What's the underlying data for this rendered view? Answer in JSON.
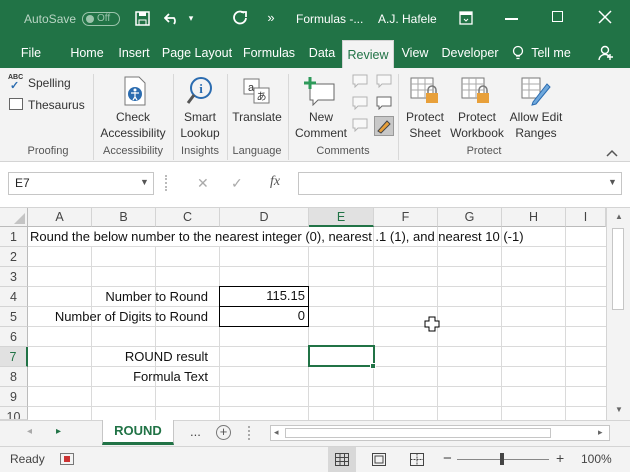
{
  "titlebar": {
    "autosave_label": "AutoSave",
    "autosave_state": "Off",
    "title": "Formulas -...",
    "user": "A.J. Hafele"
  },
  "tabs": [
    "File",
    "Home",
    "Insert",
    "Page Layout",
    "Formulas",
    "Data",
    "Review",
    "View",
    "Developer",
    "Tell me"
  ],
  "active_tab": "Review",
  "ribbon": {
    "proofing": {
      "spelling": "Spelling",
      "thesaurus": "Thesaurus",
      "label": "Proofing"
    },
    "accessibility": {
      "check": [
        "Check",
        "Accessibility"
      ],
      "label": "Accessibility"
    },
    "insights": {
      "smart": [
        "Smart",
        "Lookup"
      ],
      "label": "Insights"
    },
    "language": {
      "translate": "Translate",
      "label": "Language"
    },
    "comments": {
      "new": [
        "New",
        "Comment"
      ],
      "label": "Comments"
    },
    "protect": {
      "sheet": [
        "Protect",
        "Sheet"
      ],
      "workbook": [
        "Protect",
        "Workbook"
      ],
      "ranges": [
        "Allow Edit",
        "Ranges"
      ],
      "label": "Protect"
    }
  },
  "formula_bar": {
    "name_box": "E7",
    "formula": ""
  },
  "columns": [
    "A",
    "B",
    "C",
    "D",
    "E",
    "F",
    "G",
    "H",
    "I"
  ],
  "rows": [
    "1",
    "2",
    "3",
    "4",
    "5",
    "6",
    "7",
    "8",
    "9",
    "10"
  ],
  "selected_cell": {
    "col": "E",
    "row": "7"
  },
  "cells": {
    "A1": "Round the below number to the nearest integer (0), nearest .1 (1), and nearest 10 (-1)",
    "C4": "Number to Round",
    "D4": "115.15",
    "C5": "Number of Digits to Round",
    "D5": "0",
    "C7": "ROUND result",
    "C8": "Formula Text"
  },
  "sheet_tabs": {
    "active": "ROUND",
    "more": "..."
  },
  "status": {
    "mode": "Ready",
    "zoom": "100%"
  },
  "colors": {
    "accent": "#217346"
  }
}
